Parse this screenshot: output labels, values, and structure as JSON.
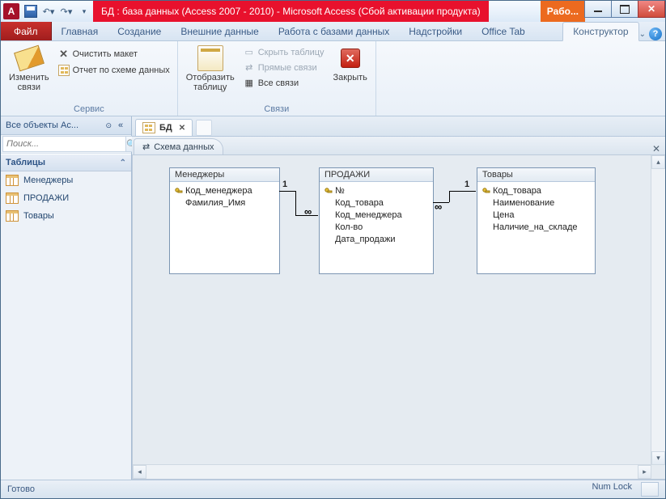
{
  "title": {
    "text": "БД : база данных (Access 2007 - 2010)  -  Microsoft Access (Сбой активации продукта)",
    "context_tab": "Рабо..."
  },
  "tabs": {
    "file": "Файл",
    "items": [
      "Главная",
      "Создание",
      "Внешние данные",
      "Работа с базами данных",
      "Надстройки",
      "Office Tab"
    ],
    "constructor": "Конструктор"
  },
  "ribbon": {
    "service": {
      "edit_links": "Изменить\nсвязи",
      "clear_layout": "Очистить макет",
      "report": "Отчет по схеме данных",
      "label": "Сервис"
    },
    "links": {
      "show_table": "Отобразить\nтаблицу",
      "hide_table": "Скрыть таблицу",
      "direct_links": "Прямые связи",
      "all_links": "Все связи",
      "close": "Закрыть",
      "label": "Связи"
    }
  },
  "nav": {
    "header": "Все объекты Ac...",
    "search_placeholder": "Поиск...",
    "category": "Таблицы",
    "items": [
      "Менеджеры",
      "ПРОДАЖИ",
      "Товары"
    ]
  },
  "doc": {
    "tab": "БД",
    "subtab": "Схема данных"
  },
  "schema": {
    "managers": {
      "title": "Менеджеры",
      "fields": [
        "Код_менеджера",
        "Фамилия_Имя"
      ],
      "key_index": 0
    },
    "sales": {
      "title": "ПРОДАЖИ",
      "fields": [
        "№",
        "Код_товара",
        "Код_менеджера",
        "Кол-во",
        "Дата_продажи"
      ],
      "key_index": 0
    },
    "goods": {
      "title": "Товары",
      "fields": [
        "Код_товара",
        "Наименование",
        "Цена",
        "Наличие_на_складе"
      ],
      "key_index": 0
    }
  },
  "status": {
    "left": "Готово",
    "numlock": "Num Lock"
  }
}
